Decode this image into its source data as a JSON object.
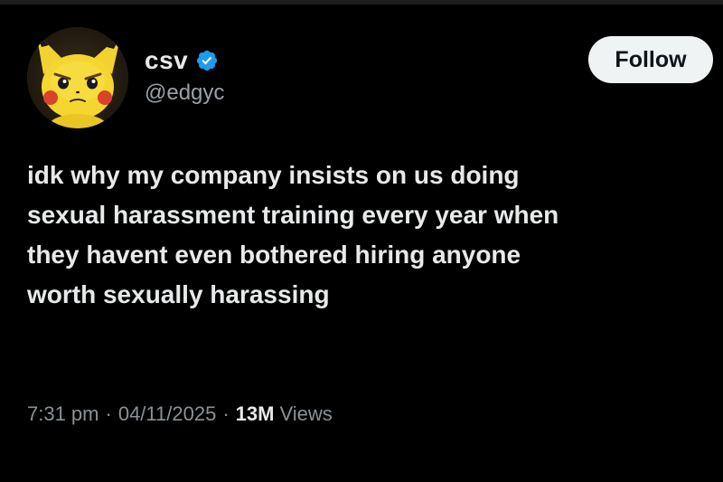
{
  "author": {
    "display_name": "csv",
    "handle": "@edgyc",
    "verified": true,
    "verified_icon": "verified-badge-icon",
    "verified_color": "#1d9bf0",
    "avatar_icon": "pikachu-avatar"
  },
  "follow_button": {
    "label": "Follow"
  },
  "tweet": {
    "text_lines": [
      "idk why my company insists on us doing",
      "sexual harassment training every year when",
      "they havent even bothered hiring anyone",
      "worth sexually harassing"
    ]
  },
  "meta": {
    "time": "7:31 pm",
    "date": "04/11/2025",
    "separator": "·",
    "views_count": "13M",
    "views_label": "Views"
  },
  "colors": {
    "background": "#000000",
    "text_primary": "#e7e9ea",
    "text_secondary": "#8b9196",
    "button_bg": "#eff3f4",
    "button_text": "#0f1419"
  }
}
